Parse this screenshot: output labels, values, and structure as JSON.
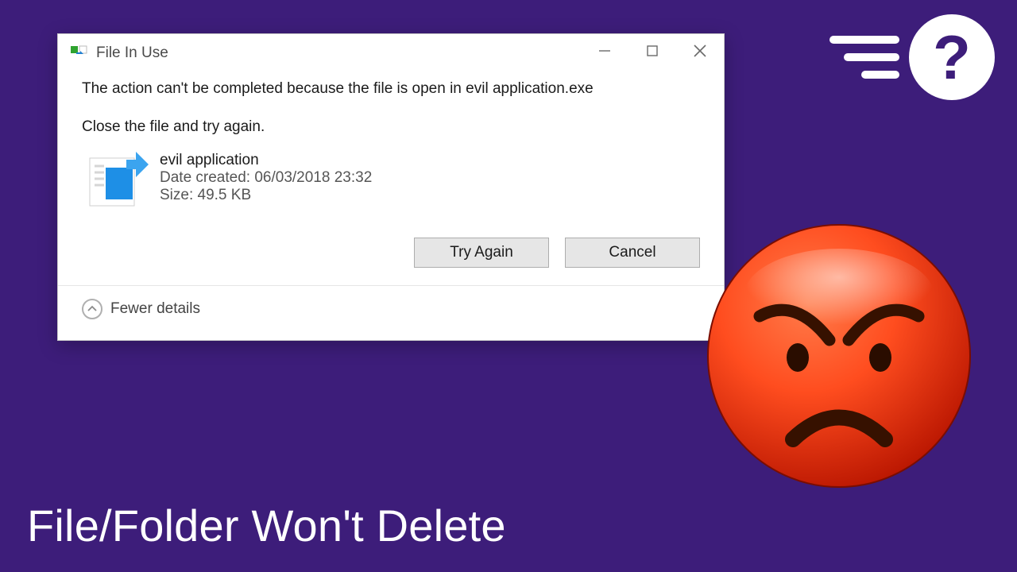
{
  "dialog": {
    "title": "File In Use",
    "message": "The action can't be completed because the file is open in evil application.exe",
    "instruction": "Close the file and try again.",
    "file": {
      "name": "evil application",
      "date_label": "Date created: 06/03/2018 23:32",
      "size_label": "Size: 49.5 KB"
    },
    "buttons": {
      "try_again": "Try Again",
      "cancel": "Cancel"
    },
    "details_toggle": "Fewer details"
  },
  "caption": "File/Folder Won't Delete"
}
